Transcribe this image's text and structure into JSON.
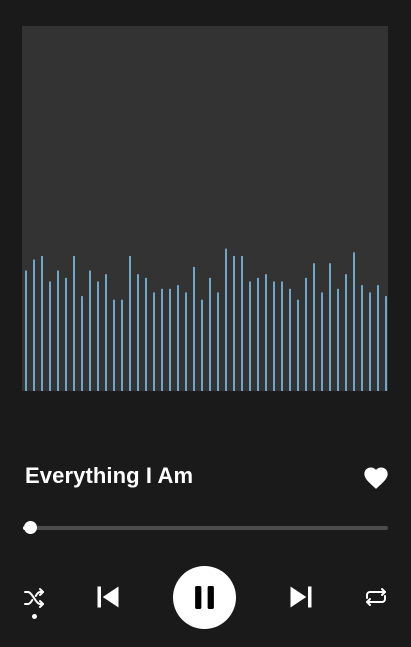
{
  "track": {
    "title": "Everything I Am",
    "liked": true
  },
  "playback": {
    "is_playing": true,
    "progress": 0.02,
    "shuffle_enabled": true,
    "repeat_enabled": false
  },
  "visualizer": {
    "bar_levels": [
      0.33,
      0.36,
      0.37,
      0.3,
      0.33,
      0.31,
      0.37,
      0.26,
      0.33,
      0.3,
      0.32,
      0.25,
      0.25,
      0.37,
      0.32,
      0.31,
      0.27,
      0.28,
      0.28,
      0.29,
      0.27,
      0.34,
      0.25,
      0.31,
      0.27,
      0.39,
      0.37,
      0.37,
      0.3,
      0.31,
      0.32,
      0.3,
      0.3,
      0.28,
      0.25,
      0.31,
      0.35,
      0.27,
      0.35,
      0.28,
      0.32,
      0.38,
      0.29,
      0.27,
      0.29,
      0.26
    ]
  },
  "icons": {
    "like": "heart-icon",
    "shuffle": "shuffle-icon",
    "previous": "skip-previous-icon",
    "play_pause": "pause-icon",
    "next": "skip-next-icon",
    "repeat": "repeat-icon"
  },
  "colors": {
    "background": "#1a1a1a",
    "artwork": "#333333",
    "bars": "#6fa7c9",
    "foreground": "#ffffff",
    "track": "#4d4d4d"
  }
}
